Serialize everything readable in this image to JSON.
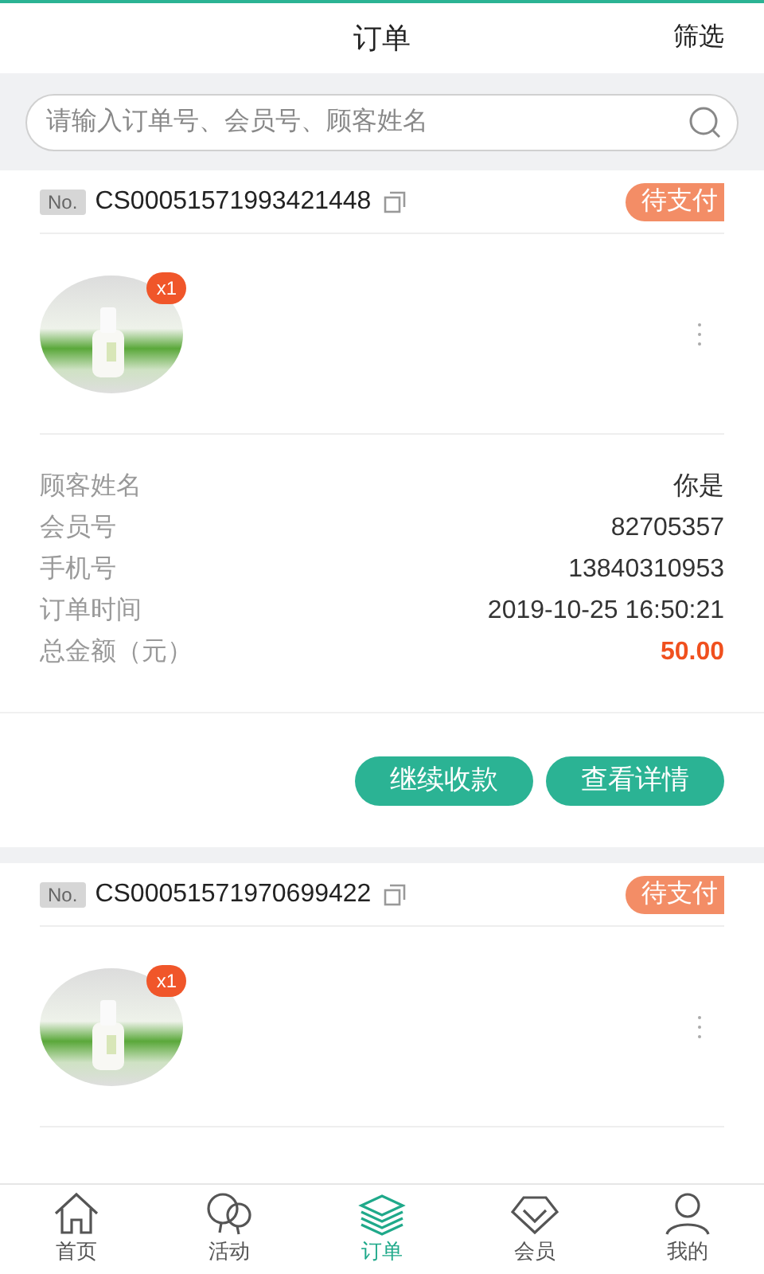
{
  "header": {
    "title": "订单",
    "filter": "筛选"
  },
  "search": {
    "placeholder": "请输入订单号、会员号、顾客姓名"
  },
  "orders": [
    {
      "no_label": "No.",
      "number": "CS00051571993421448",
      "status": "待支付",
      "items": [
        {
          "kind": "picture",
          "quantity": "x1"
        }
      ],
      "details": [
        {
          "label": "顾客姓名",
          "value": "你是",
          "kind": "plain"
        },
        {
          "label": "会员号",
          "value": "82705357",
          "kind": "plain"
        },
        {
          "label": "手机号",
          "value": "13840310953",
          "kind": "plain"
        },
        {
          "label": "订单时间",
          "value": "2019-10-25 16:50:21",
          "kind": "plain"
        },
        {
          "label": "总金额（元）",
          "value": "50.00",
          "kind": "amount"
        }
      ],
      "actions": [
        "继续收款",
        "查看详情"
      ]
    },
    {
      "no_label": "No.",
      "number": "CS00051571970699422",
      "status": "待支付",
      "items": [
        {
          "kind": "picture",
          "quantity": "x1"
        }
      ]
    }
  ],
  "tabbar": [
    {
      "label": "首页",
      "selected": false
    },
    {
      "label": "活动",
      "selected": false
    },
    {
      "label": "订单",
      "selected": true
    },
    {
      "label": "会员",
      "selected": false
    },
    {
      "label": "我的",
      "selected": false
    }
  ]
}
